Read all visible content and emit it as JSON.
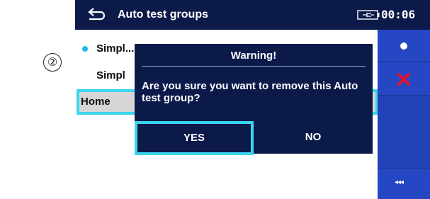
{
  "step_marker": "②",
  "header": {
    "title": "Auto test groups",
    "time": "00:06",
    "back_icon": "back-arrow-icon",
    "battery_icon": "battery-plug-icon"
  },
  "list": {
    "items": [
      {
        "label": "Simpl...",
        "bullet": true
      },
      {
        "label": "Simpl",
        "bullet": false
      }
    ],
    "selected_label": "Home"
  },
  "dialog": {
    "title": "Warning!",
    "message": "Are you sure you want to remove this Auto test group?",
    "yes_label": "YES",
    "no_label": "NO"
  },
  "panel": {
    "buttons": [
      "select-dot-icon",
      "delete-x-icon",
      "collapse-arrows-icon"
    ],
    "collapse_label": "◂◂◂"
  },
  "colors": {
    "header_bg": "#0c1a4a",
    "panel_bg": "#2242b8",
    "accent": "#3ad6ee",
    "bullet": "#22b8e8",
    "delete_red": "#e8102a"
  }
}
